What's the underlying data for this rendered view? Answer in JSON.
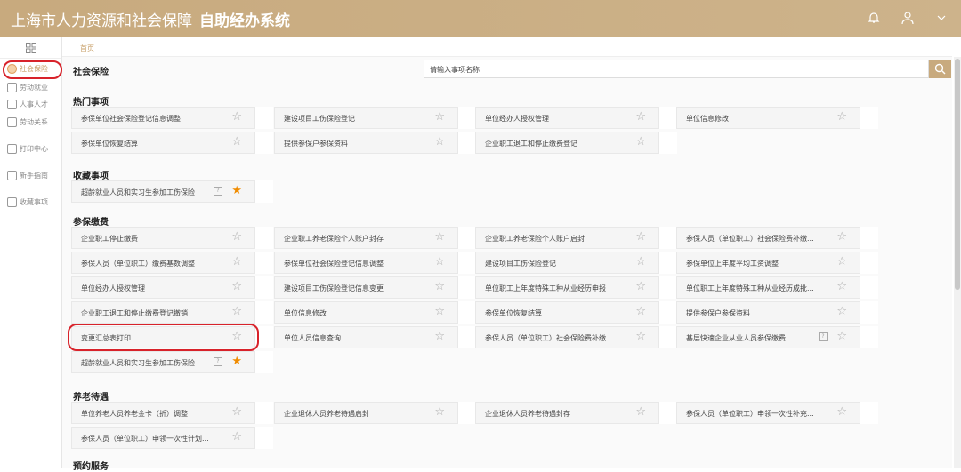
{
  "header": {
    "title": "上海市人力资源和社会保障",
    "subtitle": "自助经办系统"
  },
  "breadcrumb": "首页",
  "sidebar": [
    {
      "label": "社会保险",
      "icon": "insurance-icon",
      "active": true
    },
    {
      "label": "劳动就业",
      "icon": "person-icon"
    },
    {
      "label": "人事人才",
      "icon": "people-icon"
    },
    {
      "label": "劳动关系",
      "icon": "document-icon"
    },
    {
      "label": "打印中心",
      "icon": "printer-icon"
    },
    {
      "label": "新手指南",
      "icon": "guide-icon"
    },
    {
      "label": "收藏事项",
      "icon": "star-icon"
    }
  ],
  "page_title": "社会保险",
  "search": {
    "placeholder": "请输入事项名称"
  },
  "sections": [
    {
      "title": "热门事项",
      "items": [
        {
          "label": "参保单位社会保险登记信息调整"
        },
        {
          "label": "建设项目工伤保险登记"
        },
        {
          "label": "单位经办人授权管理"
        },
        {
          "label": "单位信息修改"
        },
        {
          "label": "参保单位恢复结算"
        },
        {
          "label": "提供参保户参保资料"
        },
        {
          "label": "企业职工退工和停止缴费登记"
        }
      ]
    },
    {
      "title": "收藏事项",
      "items": [
        {
          "label": "超龄就业人员和实习生参加工伤保险",
          "help": true,
          "starred": true
        }
      ]
    },
    {
      "title": "参保缴费",
      "items": [
        {
          "label": "企业职工停止缴费"
        },
        {
          "label": "企业职工养老保险个人账户封存"
        },
        {
          "label": "企业职工养老保险个人账户启封"
        },
        {
          "label": "参保人员（单位职工）社会保险费补缴..."
        },
        {
          "label": "参保人员（单位职工）缴费基数调整"
        },
        {
          "label": "参保单位社会保险登记信息调整"
        },
        {
          "label": "建设项目工伤保险登记"
        },
        {
          "label": "参保单位上年度平均工资调整"
        },
        {
          "label": "单位经办人授权管理"
        },
        {
          "label": "建设项目工伤保险登记信息变更"
        },
        {
          "label": "单位职工上年度特殊工种从业经历申报"
        },
        {
          "label": "单位职工上年度特殊工种从业经历成批..."
        },
        {
          "label": "企业职工退工和停止缴费登记撤销"
        },
        {
          "label": "单位信息修改"
        },
        {
          "label": "参保单位恢复结算"
        },
        {
          "label": "提供参保户参保资料"
        },
        {
          "label": "变更汇总表打印",
          "highlighted": true
        },
        {
          "label": "单位人员信息查询"
        },
        {
          "label": "参保人员（单位职工）社会保险费补缴"
        },
        {
          "label": "基层快速企业从业人员参保缴费",
          "help": true
        },
        {
          "label": "超龄就业人员和实习生参加工伤保险",
          "help": true,
          "starred": true
        }
      ]
    },
    {
      "title": "养老待遇",
      "items": [
        {
          "label": "单位养老人员养老金卡（折）调整"
        },
        {
          "label": "企业退休人员养老待遇启封"
        },
        {
          "label": "企业退休人员养老待遇封存"
        },
        {
          "label": "参保人员（单位职工）申领一次性补充..."
        },
        {
          "label": "参保人员（单位职工）申领一次性计划..."
        }
      ]
    },
    {
      "title": "预约服务",
      "items": []
    }
  ],
  "colors": {
    "brand": "#c8aa7e",
    "star_on": "#f08c00",
    "highlight_ring": "#d8222a"
  }
}
